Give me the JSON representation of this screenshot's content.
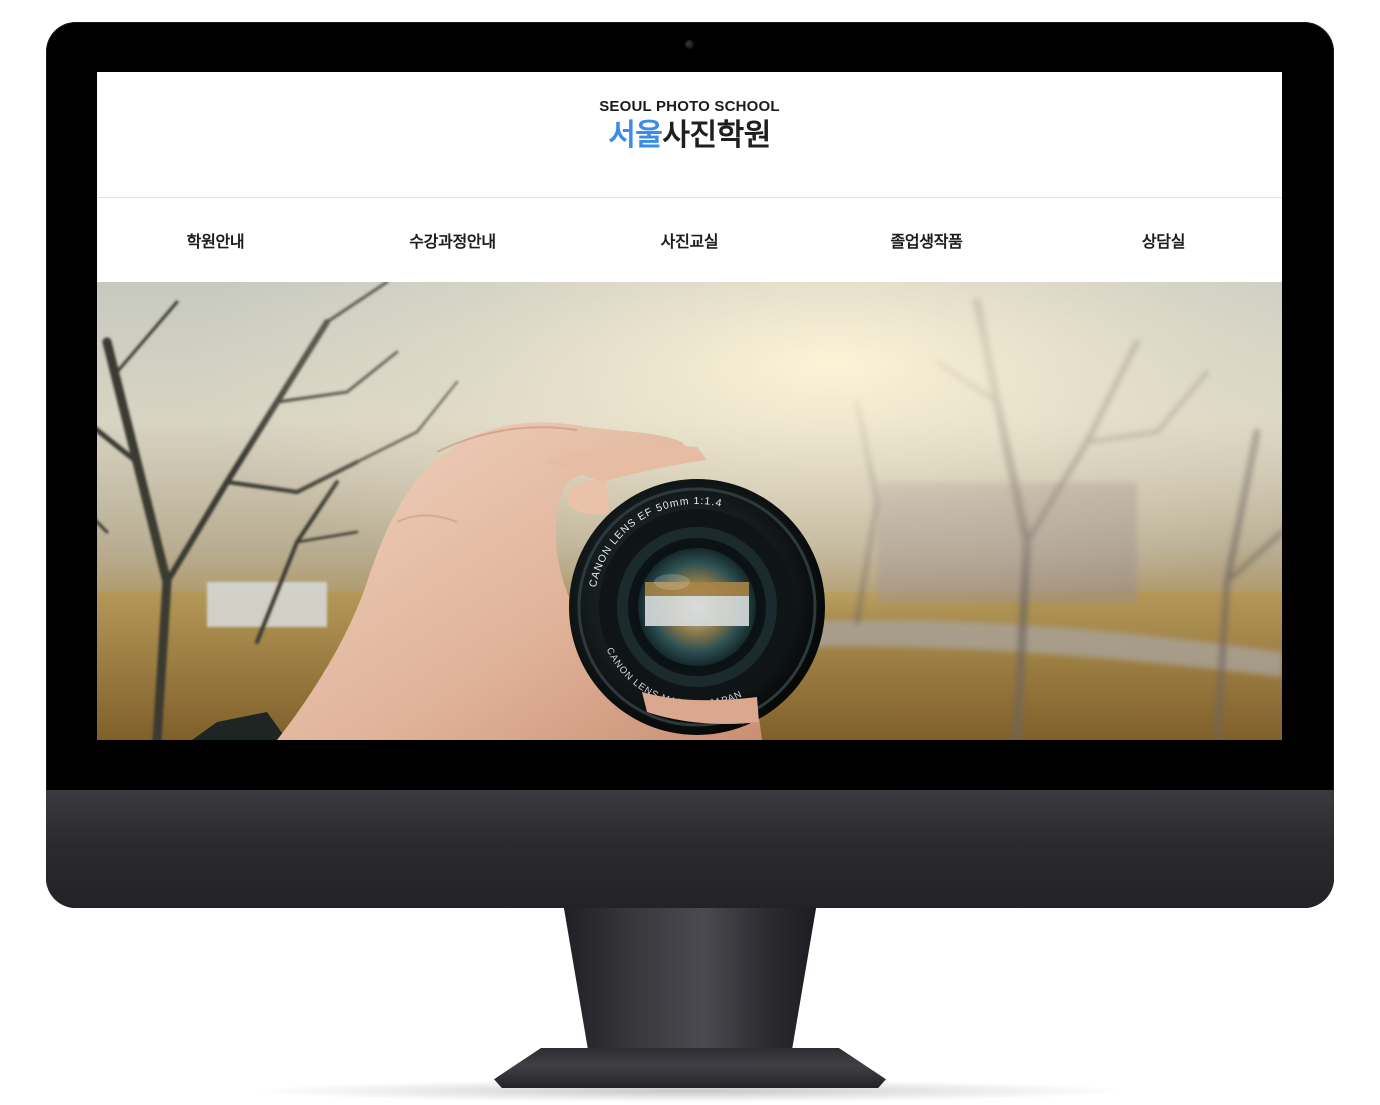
{
  "site": {
    "logo_en": "SEOUL PHOTO SCHOOL",
    "logo_ko_accent": "서울",
    "logo_ko_rest": "사진학원",
    "accent_color": "#3b8be8"
  },
  "nav": {
    "items": [
      {
        "label": "학원안내"
      },
      {
        "label": "수강과정안내"
      },
      {
        "label": "사진교실"
      },
      {
        "label": "졸업생작품"
      },
      {
        "label": "상담실"
      }
    ]
  },
  "hero": {
    "image": "hand-holding-camera-lens",
    "lens_text_top": "CANON  LENS  EF  50mm  1:1.4",
    "lens_text_bottom": "CANON   LENS   MADE   IN   JAPAN"
  }
}
